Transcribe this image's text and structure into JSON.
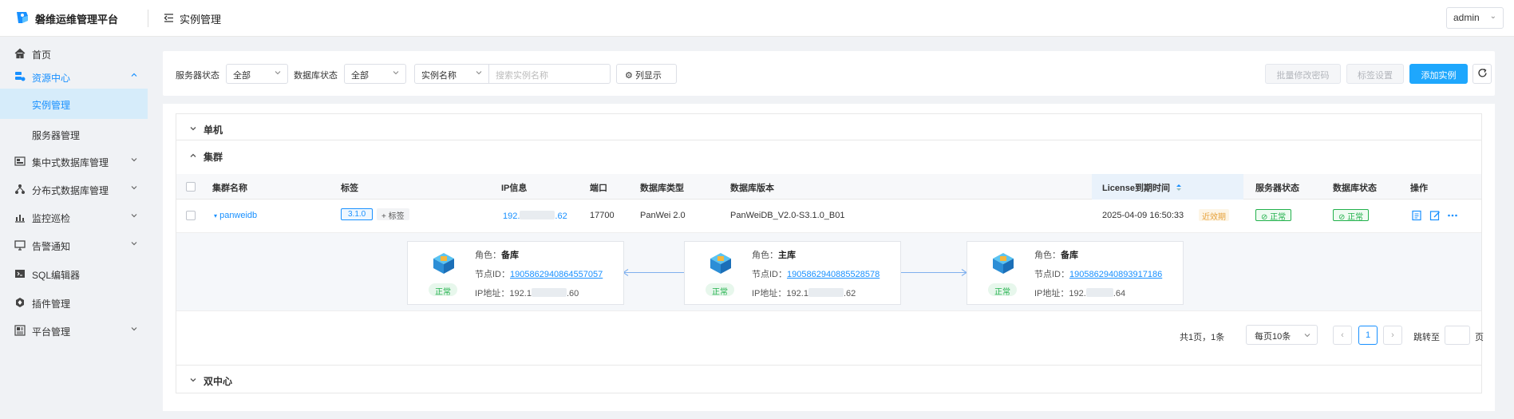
{
  "app": {
    "title": "磐维运维管理平台",
    "page_title": "实例管理",
    "user": "admin"
  },
  "sidebar": {
    "items": [
      {
        "label": "首页",
        "icon": "home-icon"
      },
      {
        "label": "资源中心",
        "icon": "resource-icon",
        "expanded": true
      },
      {
        "label": "实例管理",
        "selected": true
      },
      {
        "label": "服务器管理"
      },
      {
        "label": "集中式数据库管理",
        "icon": "database-icon"
      },
      {
        "label": "分布式数据库管理",
        "icon": "cluster-icon"
      },
      {
        "label": "监控巡检",
        "icon": "chart-icon"
      },
      {
        "label": "告警通知",
        "icon": "monitor-icon"
      },
      {
        "label": "SQL编辑器",
        "icon": "sql-icon"
      },
      {
        "label": "插件管理",
        "icon": "plugin-icon"
      },
      {
        "label": "平台管理",
        "icon": "platform-icon"
      }
    ]
  },
  "filters": {
    "server_status_label": "服务器状态",
    "server_status_value": "全部",
    "db_status_label": "数据库状态",
    "db_status_value": "全部",
    "search_field": "实例名称",
    "search_placeholder": "搜索实例名称",
    "columns_button": "列显示",
    "batch_password_button": "批量修改密码",
    "tag_settings_button": "标签设置",
    "add_instance_button": "添加实例"
  },
  "groups": {
    "single": "单机",
    "cluster": "集群",
    "dual_center": "双中心"
  },
  "table": {
    "columns": [
      "集群名称",
      "标签",
      "IP信息",
      "端口",
      "数据库类型",
      "数据库版本",
      "License到期时间",
      "服务器状态",
      "数据库状态",
      "操作"
    ],
    "rows": [
      {
        "name": "panweidb",
        "tag": "3.1.0",
        "add_tag": "+ 标签",
        "ip_prefix": "192.",
        "ip_suffix": ".62",
        "port": "17700",
        "db_type": "PanWei 2.0",
        "db_version": "PanWeiDB_V2.0-S3.1.0_B01",
        "license": "2025-04-09 16:50:33",
        "license_tag": "近效期",
        "server_status": "正常",
        "db_status": "正常"
      }
    ]
  },
  "nodes": [
    {
      "role_label": "角色：",
      "role": "备库",
      "id_label": "节点ID：",
      "id": "1905862940864557057",
      "ip_label": "IP地址：",
      "ip_prefix": "192.1",
      "ip_suffix": ".60",
      "status": "正常"
    },
    {
      "role_label": "角色：",
      "role": "主库",
      "id_label": "节点ID：",
      "id": "1905862940885528578",
      "ip_label": "IP地址：",
      "ip_prefix": "192.1",
      "ip_suffix": ".62",
      "status": "正常"
    },
    {
      "role_label": "角色：",
      "role": "备库",
      "id_label": "节点ID：",
      "id": "1905862940893917186",
      "ip_label": "IP地址：",
      "ip_prefix": "192.",
      "ip_suffix": ".64",
      "status": "正常"
    }
  ],
  "pagination": {
    "summary": "共1页，1条",
    "page_size": "每页10条",
    "current_page": "1",
    "goto_label": "跳转至",
    "page_unit": "页"
  },
  "colors": {
    "primary": "#1ea7fd",
    "link": "#1890ff",
    "success": "#22b14c",
    "warning": "#e6a23c"
  }
}
